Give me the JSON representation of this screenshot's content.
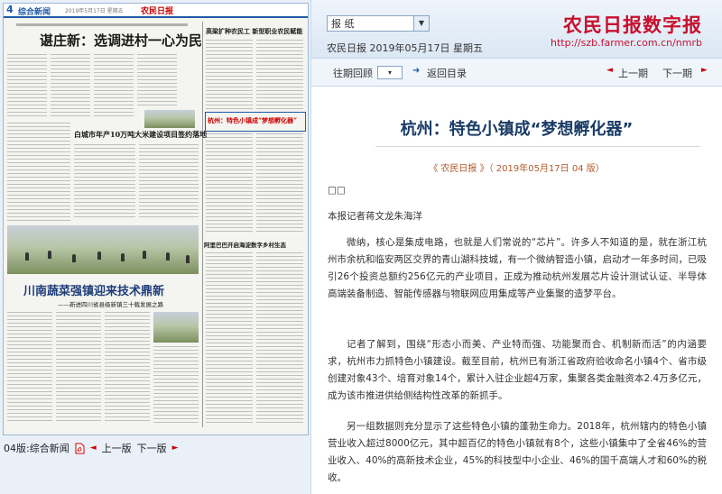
{
  "newspaper": {
    "page_no": "4",
    "section": "综合新闻",
    "date_line": "2019年5月17日 星期五",
    "masthead": "农民日报",
    "headlines": {
      "h1": "谌庄新：选调进村一心为民",
      "h2": "高粱扩种农民工 新型职业农民赋能",
      "h3": "杭州：特色小镇成“梦想孵化器”",
      "h4": "白城市年产10万吨大米建设项目签约落地",
      "h5": "阿里巴巴开启海淀数字乡村生态",
      "h6": "川南蔬菜强镇迎来技术鼎新",
      "h6_sub": "——新进四川省县级新镇三十载发展之路"
    }
  },
  "page_nav": {
    "page_label": "04版:综合新闻",
    "prev": "上一版",
    "next": "下一版"
  },
  "header": {
    "select_value": "报 纸",
    "brand": "农民日报数字报",
    "url": "http://szb.farmer.com.cn/nmrb",
    "pub_date": "农民日报 2019年05月17日 星期五"
  },
  "nav": {
    "archive": "往期回顾",
    "back_home": "返回目录",
    "prev_page": "上一期",
    "next_page": "下一期"
  },
  "article": {
    "title": "杭州：特色小镇成“梦想孵化器”",
    "source": "《 农民日报 》（ 2019年05月17日 04 版）",
    "label": "□□",
    "byline": "本报记者蒋文龙朱海洋",
    "p1": "微纳，核心是集成电路，也就是人们常说的“芯片”。许多人不知道的是，就在浙江杭州市余杭和临安两区交界的青山湖科技城，有一个微纳智造小镇，启动才一年多时间，已吸引26个投资总额约256亿元的产业项目，正成为推动杭州发展芯片设计测试认证、半导体高端装备制造、智能传感器与物联网应用集成等产业集聚的造梦平台。",
    "p2": "记者了解到，围绕“形态小而美、产业特而强、功能聚而合、机制新而活”的内涵要求，杭州市力抓特色小镇建设。截至目前，杭州已有浙江省政府验收命名小镇4个、省市级创建对象43个、培育对象14个，累计入驻企业超4万家，集聚各类金融资本2.4万多亿元，成为该市推进供给侧结构性改革的新抓手。",
    "p3": "另一组数据则充分显示了这些特色小镇的蓬勃生命力。2018年，杭州辖内的特色小镇营业收入超过8000亿元，其中超百亿的特色小镇就有8个，这些小镇集中了全省46%的营业收入、40%的高新技术企业，45%的科技型中小企业、46%的国千高端人才和60%的税收。"
  },
  "colors": {
    "brand_red": "#c8102e",
    "title_blue": "#1a3c66",
    "source_brown": "#b05a2a"
  }
}
